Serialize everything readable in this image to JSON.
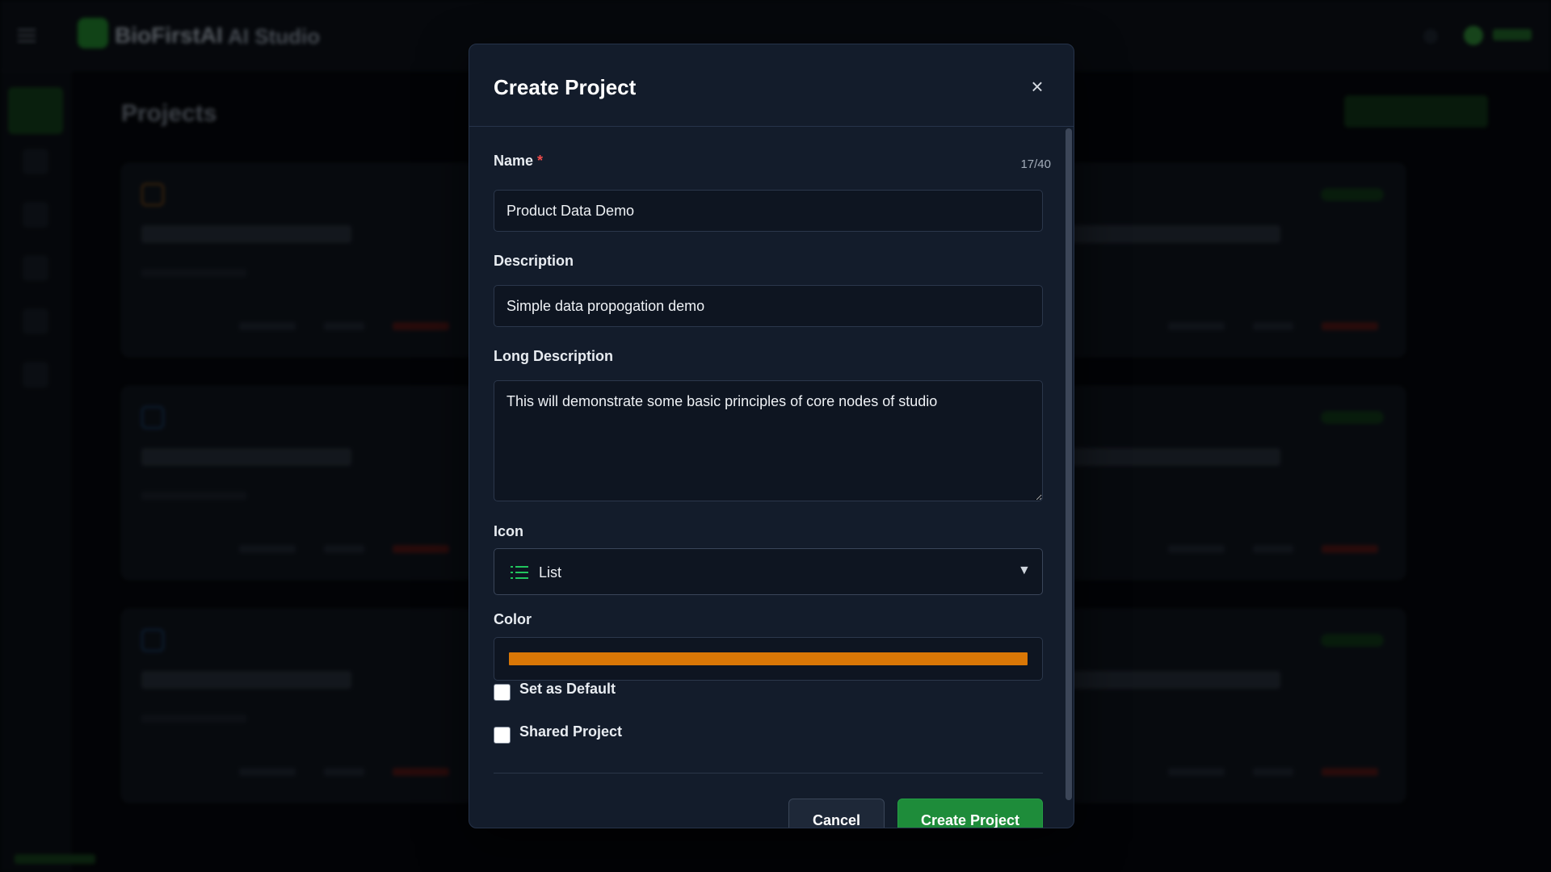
{
  "app": {
    "brand_name": "BioFirstAI",
    "brand_sub": "AI Studio",
    "page_title": "Projects"
  },
  "modal": {
    "title": "Create Project",
    "close_symbol": "×",
    "name": {
      "label": "Name",
      "required_mark": "*",
      "counter": "17/40",
      "value": "Product Data Demo"
    },
    "description": {
      "label": "Description",
      "value": "Simple data propogation demo"
    },
    "long_description": {
      "label": "Long Description",
      "value": "This will demonstrate some basic principles of core nodes of studio"
    },
    "icon": {
      "label": "Icon",
      "selected": "List",
      "selected_icon": "list-icon",
      "icon_color": "#22c55e",
      "caret": "▼"
    },
    "color": {
      "label": "Color",
      "value": "#d97706"
    },
    "set_default": {
      "label": "Set as Default",
      "checked": false
    },
    "shared_project": {
      "label": "Shared Project",
      "checked": false
    },
    "buttons": {
      "cancel": "Cancel",
      "create": "Create Project"
    }
  }
}
